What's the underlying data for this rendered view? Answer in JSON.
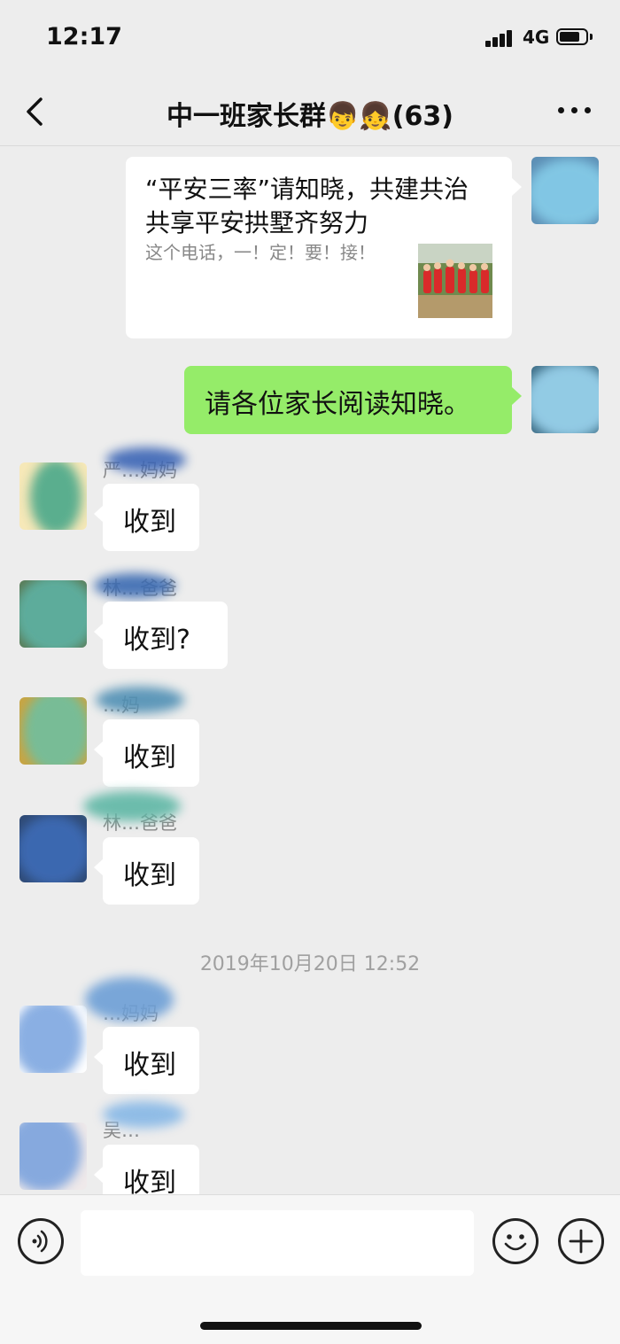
{
  "status": {
    "time": "12:17",
    "network": "4G"
  },
  "header": {
    "title": "中一班家长群👦👧(63)"
  },
  "messages": {
    "link_card": {
      "title": "“平安三率”请知晓，共建共治共享平安拱墅齐努力",
      "description": "这个电话，一！定！要！接！"
    },
    "outgoing_text": "请各位家长阅读知晓。",
    "replies": [
      {
        "sender": "严…妈妈",
        "text": "收到"
      },
      {
        "sender": "林…爸爸",
        "text": "收到?"
      },
      {
        "sender": "…妈",
        "text": "收到"
      },
      {
        "sender": "林…爸爸",
        "text": "收到"
      }
    ],
    "timestamp": "2019年10月20日 12:52",
    "replies_after": [
      {
        "sender": "…妈妈",
        "text": "收到"
      },
      {
        "sender": "吴…",
        "text": "收到"
      }
    ]
  },
  "input": {
    "placeholder": ""
  },
  "colors": {
    "background": "#ededed",
    "outgoing_bubble": "#95ec69",
    "incoming_bubble": "#ffffff"
  }
}
